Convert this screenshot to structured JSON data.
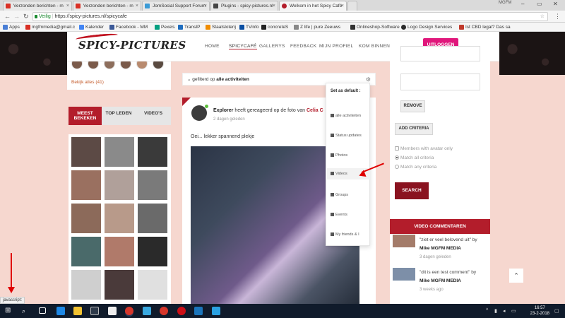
{
  "browser": {
    "tabs": [
      {
        "label": "Verzonden berichten - m",
        "color": "#d93025"
      },
      {
        "label": "Verzonden berichten - m",
        "color": "#d93025"
      },
      {
        "label": "JomSocial Support Forum",
        "color": "#3b9bd6"
      },
      {
        "label": "Plugins - spicy-pictures.nl",
        "color": "#464646"
      },
      {
        "label": "Welkom in het Spicy Café",
        "color": "#b31d2b"
      }
    ],
    "window_user": "MGFM",
    "secure_label": "Veilig",
    "url": "https://spicy-pictures.nl/spicycafe",
    "bookmarks": [
      "Apps",
      "mgfmmedia@gmail.c",
      "Kalender",
      "Facebook - MM",
      "Pexels",
      "TransIP",
      "Staatsloterij",
      "TVinfo",
      "concreteS",
      "Z life | pure Zeeuws",
      "Onlineshop-Software",
      "Logo Design Services",
      "Ist CBD legal? Das sa"
    ]
  },
  "site": {
    "logo": "SPICY-PICTURES",
    "menu": [
      "HOME",
      "SPICYCAFÉ",
      "GALLERYS",
      "FEEDBACK",
      "MIJN PROFIEL",
      "KOM BINNEN"
    ],
    "logout_label": "UITLOGGEN",
    "accent": "#b31d2b"
  },
  "left": {
    "see_all": "Bekijk alles (41)",
    "tabs": [
      "MEEST BEKEKEN",
      "TOP LEDEN",
      "VIDEO'S"
    ],
    "thumb_colors": [
      "#5c4a45",
      "#8a8a8a",
      "#3a3a3a",
      "#9a7060",
      "#b0a09a",
      "#7a7a7a",
      "#8c6a5a",
      "#b89a8a",
      "#6a6a6a",
      "#4a6a6a",
      "#b07a6a",
      "#2a2a2a",
      "#cfcfcf",
      "#4a3a3a",
      "#e0e0e0"
    ]
  },
  "feed": {
    "filter_prefix": "gefilterd op",
    "filter_value": "alle activiteiten",
    "post": {
      "username": "Explorer",
      "action": "heeft gereageerd op de foto van",
      "target": "Celia C",
      "time": "2 dagen geleden",
      "text": "Oei... lekker spannend plekje"
    },
    "dropdown": {
      "title": "Set as default :",
      "items": [
        "alle activiteiten",
        "Status updates",
        "Photos",
        "Videos",
        "Groups",
        "Events",
        "My friends & I"
      ],
      "highlighted": "Videos"
    }
  },
  "right": {
    "remove_label": "REMOVE",
    "add_criteria_label": "ADD CRITERIA",
    "options": [
      "Members with avatar only",
      "Match all criteria",
      "Match any criteria"
    ],
    "selected_option": "Match all criteria",
    "search_label": "SEARCH",
    "video_comments_title": "VIDEO COMMENTAREN",
    "comments": [
      {
        "quote": "\"ziet er veel belovend uit\" by",
        "author": "Mike MGFM MEDIA",
        "time": "3 dagen geleden"
      },
      {
        "quote": "\"dit is een test comment\" by",
        "author": "Mike MGFM MEDIA",
        "time": "3 weeks ago"
      }
    ]
  },
  "status_text": "javascript:",
  "taskbar": {
    "time": "16:57",
    "date": "23-2-2018"
  }
}
